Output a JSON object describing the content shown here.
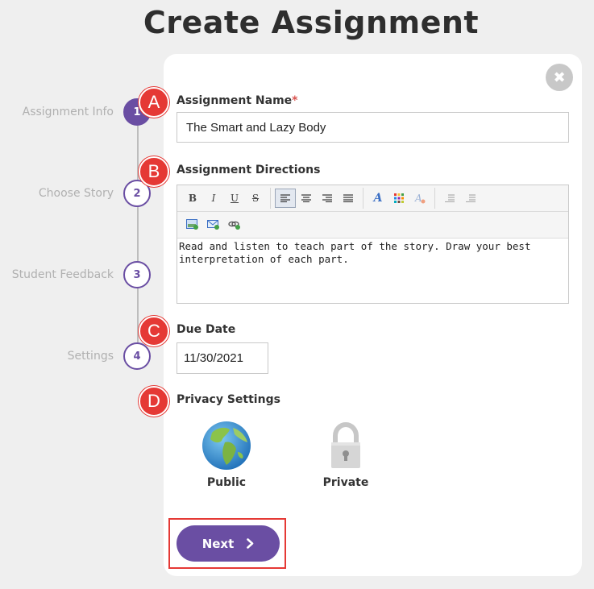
{
  "page": {
    "title": "Create Assignment"
  },
  "stepper": {
    "steps": [
      {
        "label": "Assignment Info",
        "number": "1"
      },
      {
        "label": "Choose Story",
        "number": "2"
      },
      {
        "label": "Student Feedback",
        "number": "3"
      },
      {
        "label": "Settings",
        "number": "4"
      }
    ],
    "active_step": 1
  },
  "close_button": {
    "icon": "close-icon",
    "glyph": "✖"
  },
  "markers": [
    "A",
    "B",
    "C",
    "D"
  ],
  "form": {
    "assignment_name": {
      "label": "Assignment Name",
      "required_mark": "*",
      "value": "The Smart and Lazy Body"
    },
    "directions": {
      "label": "Assignment Directions",
      "text_line1": "Read and listen to teach part of the story. Draw your best",
      "text_line2": "interpretation of each part."
    },
    "due_date": {
      "label": "Due Date",
      "value": "11/30/2021"
    },
    "privacy": {
      "label": "Privacy Settings",
      "options": [
        {
          "label": "Public",
          "icon": "globe-icon"
        },
        {
          "label": "Private",
          "icon": "padlock-icon"
        }
      ]
    }
  },
  "toolbar": {
    "bold": "B",
    "italic": "I",
    "underline": "U",
    "strike": "S",
    "font_style": "A"
  },
  "next_button": {
    "label": "Next",
    "icon": "chevron-right-icon"
  },
  "colors": {
    "accent": "#6a4ea3",
    "marker": "#e53935",
    "background": "#efefef"
  }
}
